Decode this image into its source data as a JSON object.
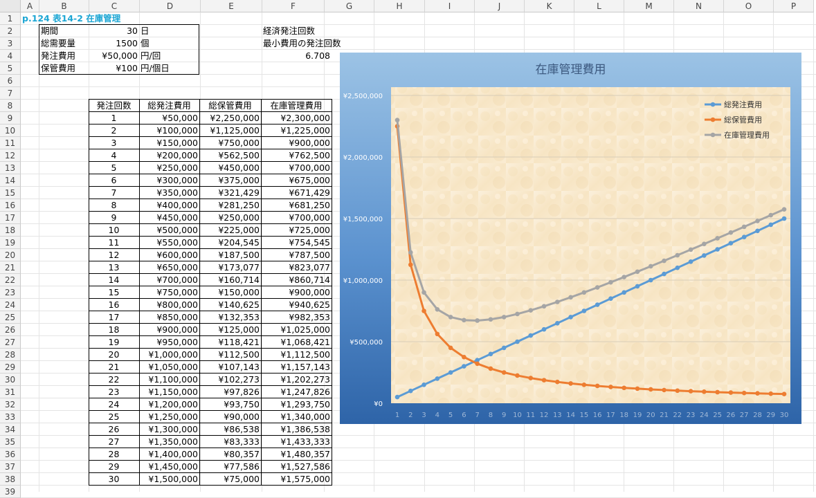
{
  "columns": [
    "A",
    "B",
    "C",
    "D",
    "E",
    "F",
    "G",
    "H",
    "I",
    "J",
    "K",
    "L",
    "M",
    "N",
    "O",
    "P"
  ],
  "rows": [
    "1",
    "2",
    "3",
    "4",
    "5",
    "6",
    "7",
    "8",
    "9",
    "10",
    "11",
    "12",
    "13",
    "14",
    "15",
    "16",
    "17",
    "18",
    "19",
    "20",
    "21",
    "22",
    "23",
    "24",
    "25",
    "26",
    "27",
    "28",
    "29",
    "30",
    "31",
    "32",
    "33",
    "34",
    "35",
    "36",
    "37",
    "38",
    "39"
  ],
  "title": "p.124 表14-2 在庫管理",
  "params": [
    {
      "label": "期間",
      "value": "30",
      "unit": "日"
    },
    {
      "label": "総需要量",
      "value": "1500",
      "unit": "個"
    },
    {
      "label": "発注費用",
      "value": "¥50,000",
      "unit": "円/回"
    },
    {
      "label": "保管費用",
      "value": "¥100",
      "unit": "円/個日"
    }
  ],
  "notes": {
    "eoq_label": "経済発注回数",
    "min_cost_label": "最小費用の発注回数",
    "eoq_value": "6.708"
  },
  "table": {
    "headers": [
      "発注回数",
      "総発注費用",
      "総保管費用",
      "在庫管理費用"
    ],
    "rows": [
      [
        "1",
        "¥50,000",
        "¥2,250,000",
        "¥2,300,000"
      ],
      [
        "2",
        "¥100,000",
        "¥1,125,000",
        "¥1,225,000"
      ],
      [
        "3",
        "¥150,000",
        "¥750,000",
        "¥900,000"
      ],
      [
        "4",
        "¥200,000",
        "¥562,500",
        "¥762,500"
      ],
      [
        "5",
        "¥250,000",
        "¥450,000",
        "¥700,000"
      ],
      [
        "6",
        "¥300,000",
        "¥375,000",
        "¥675,000"
      ],
      [
        "7",
        "¥350,000",
        "¥321,429",
        "¥671,429"
      ],
      [
        "8",
        "¥400,000",
        "¥281,250",
        "¥681,250"
      ],
      [
        "9",
        "¥450,000",
        "¥250,000",
        "¥700,000"
      ],
      [
        "10",
        "¥500,000",
        "¥225,000",
        "¥725,000"
      ],
      [
        "11",
        "¥550,000",
        "¥204,545",
        "¥754,545"
      ],
      [
        "12",
        "¥600,000",
        "¥187,500",
        "¥787,500"
      ],
      [
        "13",
        "¥650,000",
        "¥173,077",
        "¥823,077"
      ],
      [
        "14",
        "¥700,000",
        "¥160,714",
        "¥860,714"
      ],
      [
        "15",
        "¥750,000",
        "¥150,000",
        "¥900,000"
      ],
      [
        "16",
        "¥800,000",
        "¥140,625",
        "¥940,625"
      ],
      [
        "17",
        "¥850,000",
        "¥132,353",
        "¥982,353"
      ],
      [
        "18",
        "¥900,000",
        "¥125,000",
        "¥1,025,000"
      ],
      [
        "19",
        "¥950,000",
        "¥118,421",
        "¥1,068,421"
      ],
      [
        "20",
        "¥1,000,000",
        "¥112,500",
        "¥1,112,500"
      ],
      [
        "21",
        "¥1,050,000",
        "¥107,143",
        "¥1,157,143"
      ],
      [
        "22",
        "¥1,100,000",
        "¥102,273",
        "¥1,202,273"
      ],
      [
        "23",
        "¥1,150,000",
        "¥97,826",
        "¥1,247,826"
      ],
      [
        "24",
        "¥1,200,000",
        "¥93,750",
        "¥1,293,750"
      ],
      [
        "25",
        "¥1,250,000",
        "¥90,000",
        "¥1,340,000"
      ],
      [
        "26",
        "¥1,300,000",
        "¥86,538",
        "¥1,386,538"
      ],
      [
        "27",
        "¥1,350,000",
        "¥83,333",
        "¥1,433,333"
      ],
      [
        "28",
        "¥1,400,000",
        "¥80,357",
        "¥1,480,357"
      ],
      [
        "29",
        "¥1,450,000",
        "¥77,586",
        "¥1,527,586"
      ],
      [
        "30",
        "¥1,500,000",
        "¥75,000",
        "¥1,575,000"
      ]
    ]
  },
  "chart_data": {
    "type": "line",
    "title": "在庫管理費用",
    "x": [
      1,
      2,
      3,
      4,
      5,
      6,
      7,
      8,
      9,
      10,
      11,
      12,
      13,
      14,
      15,
      16,
      17,
      18,
      19,
      20,
      21,
      22,
      23,
      24,
      25,
      26,
      27,
      28,
      29,
      30
    ],
    "ylim": [
      0,
      2500000
    ],
    "yticks": [
      "¥0",
      "¥500,000",
      "¥1,000,000",
      "¥1,500,000",
      "¥2,000,000",
      "¥2,500,000"
    ],
    "grid": true,
    "legend": "top-right",
    "series": [
      {
        "name": "総発注費用",
        "color": "#5b9bd5",
        "values": [
          50000,
          100000,
          150000,
          200000,
          250000,
          300000,
          350000,
          400000,
          450000,
          500000,
          550000,
          600000,
          650000,
          700000,
          750000,
          800000,
          850000,
          900000,
          950000,
          1000000,
          1050000,
          1100000,
          1150000,
          1200000,
          1250000,
          1300000,
          1350000,
          1400000,
          1450000,
          1500000
        ]
      },
      {
        "name": "総保管費用",
        "color": "#ed7d31",
        "values": [
          2250000,
          1125000,
          750000,
          562500,
          450000,
          375000,
          321429,
          281250,
          250000,
          225000,
          204545,
          187500,
          173077,
          160714,
          150000,
          140625,
          132353,
          125000,
          118421,
          112500,
          107143,
          102273,
          97826,
          93750,
          90000,
          86538,
          83333,
          80357,
          77586,
          75000
        ]
      },
      {
        "name": "在庫管理費用",
        "color": "#a5a5a5",
        "values": [
          2300000,
          1225000,
          900000,
          762500,
          700000,
          675000,
          671429,
          681250,
          700000,
          725000,
          754545,
          787500,
          823077,
          860714,
          900000,
          940625,
          982353,
          1025000,
          1068421,
          1112500,
          1157143,
          1202273,
          1247826,
          1293750,
          1340000,
          1386538,
          1433333,
          1480357,
          1527586,
          1575000
        ]
      }
    ]
  }
}
